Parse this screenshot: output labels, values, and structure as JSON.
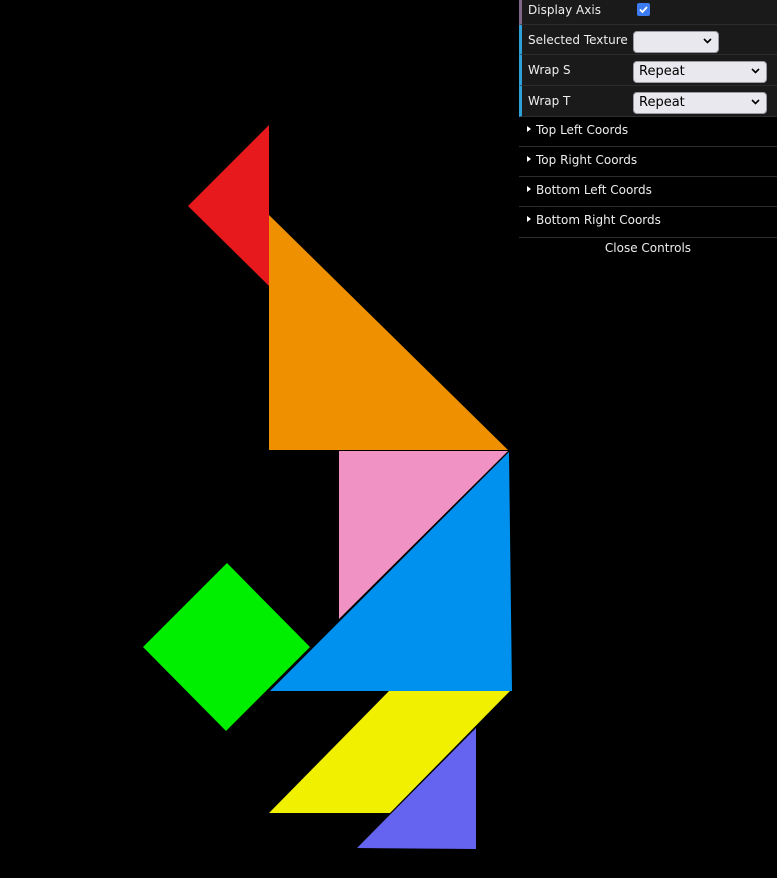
{
  "controls": {
    "display_axis": {
      "label": "Display Axis",
      "checked": true
    },
    "selected_texture": {
      "label": "Selected Texture",
      "value": ""
    },
    "wrap_s": {
      "label": "Wrap S",
      "value": "Repeat"
    },
    "wrap_t": {
      "label": "Wrap T",
      "value": "Repeat"
    },
    "folders": [
      {
        "label": "Top Left Coords"
      },
      {
        "label": "Top Right Coords"
      },
      {
        "label": "Bottom Left Coords"
      },
      {
        "label": "Bottom Right Coords"
      }
    ],
    "close_label": "Close Controls"
  },
  "pieces": [
    {
      "name": "red-small-triangle",
      "color": "#e8191c"
    },
    {
      "name": "orange-large-triangle",
      "color": "#ee9000"
    },
    {
      "name": "pink-medium-triangle",
      "color": "#f093c4"
    },
    {
      "name": "blue-large-triangle",
      "color": "#0090ee"
    },
    {
      "name": "green-square",
      "color": "#00ee00"
    },
    {
      "name": "yellow-parallelogram",
      "color": "#f0f000"
    },
    {
      "name": "purple-small-triangle",
      "color": "#6464f0"
    }
  ]
}
